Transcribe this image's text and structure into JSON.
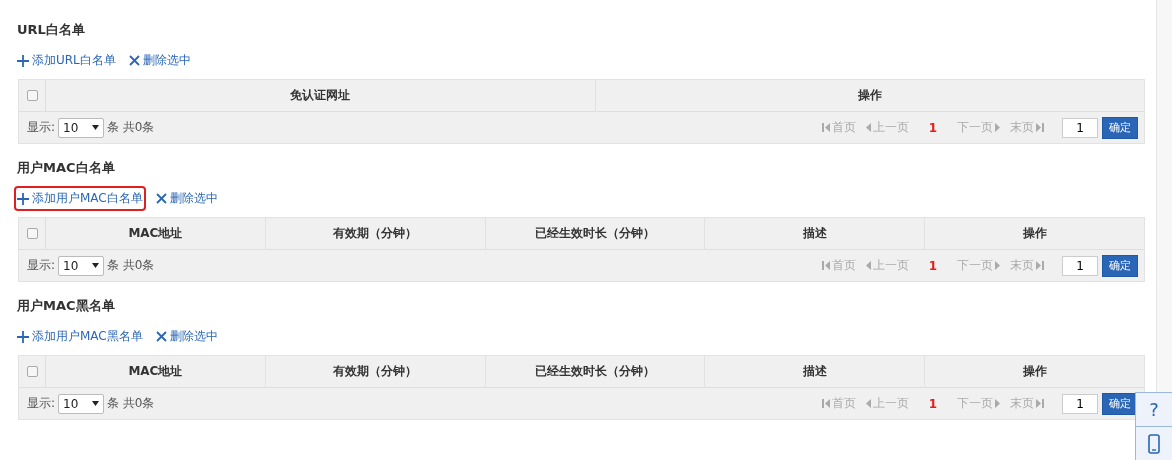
{
  "sections": [
    {
      "title": "URL白名单",
      "actions": [
        {
          "kind": "add",
          "label": "添加URL白名单",
          "highlighted": false
        },
        {
          "kind": "delete",
          "label": "删除选中",
          "highlighted": false
        }
      ],
      "select_all": {
        "checked": false
      },
      "columns": [
        "免认证网址",
        "操作"
      ],
      "footer": {
        "show_label": "显示:",
        "page_size": "10",
        "count_text": "条 共0条",
        "pager": [
          {
            "kind": "first",
            "label": "首页",
            "disabled": true
          },
          {
            "kind": "prev",
            "label": "上一页",
            "disabled": true
          },
          {
            "kind": "current",
            "label": "1"
          },
          {
            "kind": "next",
            "label": "下一页",
            "disabled": true
          },
          {
            "kind": "last",
            "label": "末页",
            "disabled": true
          }
        ],
        "page_input": "1",
        "confirm": "确定"
      }
    },
    {
      "title": "用户MAC白名单",
      "actions": [
        {
          "kind": "add",
          "label": "添加用户MAC白名单",
          "highlighted": true
        },
        {
          "kind": "delete",
          "label": "删除选中",
          "highlighted": false
        }
      ],
      "select_all": {
        "checked": false
      },
      "columns": [
        "MAC地址",
        "有效期（分钟）",
        "已经生效时长（分钟）",
        "描述",
        "操作"
      ],
      "footer": {
        "show_label": "显示:",
        "page_size": "10",
        "count_text": "条 共0条",
        "pager": [
          {
            "kind": "first",
            "label": "首页",
            "disabled": true
          },
          {
            "kind": "prev",
            "label": "上一页",
            "disabled": true
          },
          {
            "kind": "current",
            "label": "1"
          },
          {
            "kind": "next",
            "label": "下一页",
            "disabled": true
          },
          {
            "kind": "last",
            "label": "末页",
            "disabled": true
          }
        ],
        "page_input": "1",
        "confirm": "确定"
      }
    },
    {
      "title": "用户MAC黑名单",
      "actions": [
        {
          "kind": "add",
          "label": "添加用户MAC黑名单",
          "highlighted": false
        },
        {
          "kind": "delete",
          "label": "删除选中",
          "highlighted": false
        }
      ],
      "select_all": {
        "checked": false
      },
      "columns": [
        "MAC地址",
        "有效期（分钟）",
        "已经生效时长（分钟）",
        "描述",
        "操作"
      ],
      "footer": {
        "show_label": "显示:",
        "page_size": "10",
        "count_text": "条 共0条",
        "pager": [
          {
            "kind": "first",
            "label": "首页",
            "disabled": true
          },
          {
            "kind": "prev",
            "label": "上一页",
            "disabled": true
          },
          {
            "kind": "current",
            "label": "1"
          },
          {
            "kind": "next",
            "label": "下一页",
            "disabled": true
          },
          {
            "kind": "last",
            "label": "末页",
            "disabled": true
          }
        ],
        "page_input": "1",
        "confirm": "确定"
      }
    }
  ],
  "float_tools": [
    {
      "kind": "help",
      "label": "?"
    },
    {
      "kind": "phone"
    }
  ]
}
